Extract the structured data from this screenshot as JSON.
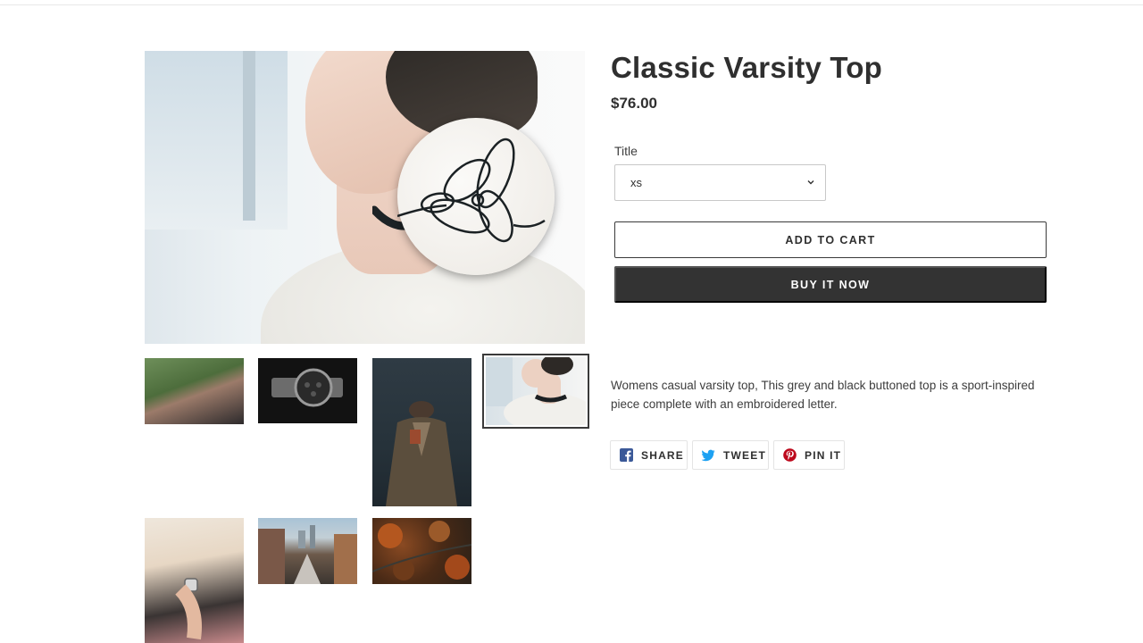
{
  "product": {
    "title": "Classic Varsity Top",
    "price": "$76.00",
    "variant_label": "Title",
    "variant_selected": "xs",
    "add_to_cart_label": "ADD TO CART",
    "buy_now_label": "BUY IT NOW",
    "description": "Womens casual varsity top, This grey and black buttoned top is a sport-inspired piece complete with an embroidered letter."
  },
  "share": {
    "facebook_label": "SHARE",
    "twitter_label": "TWEET",
    "pinterest_label": "PIN IT"
  },
  "colors": {
    "accent_dark": "#333333",
    "facebook": "#3b5998",
    "twitter": "#1da1f2",
    "pinterest": "#bd081c"
  },
  "gallery": {
    "active_thumbnail": 4,
    "thumbnails": [
      "couple",
      "wristwatch",
      "mannequin-jacket",
      "lace-choker",
      "hand-watch",
      "city-street",
      "autumn-forest"
    ]
  }
}
